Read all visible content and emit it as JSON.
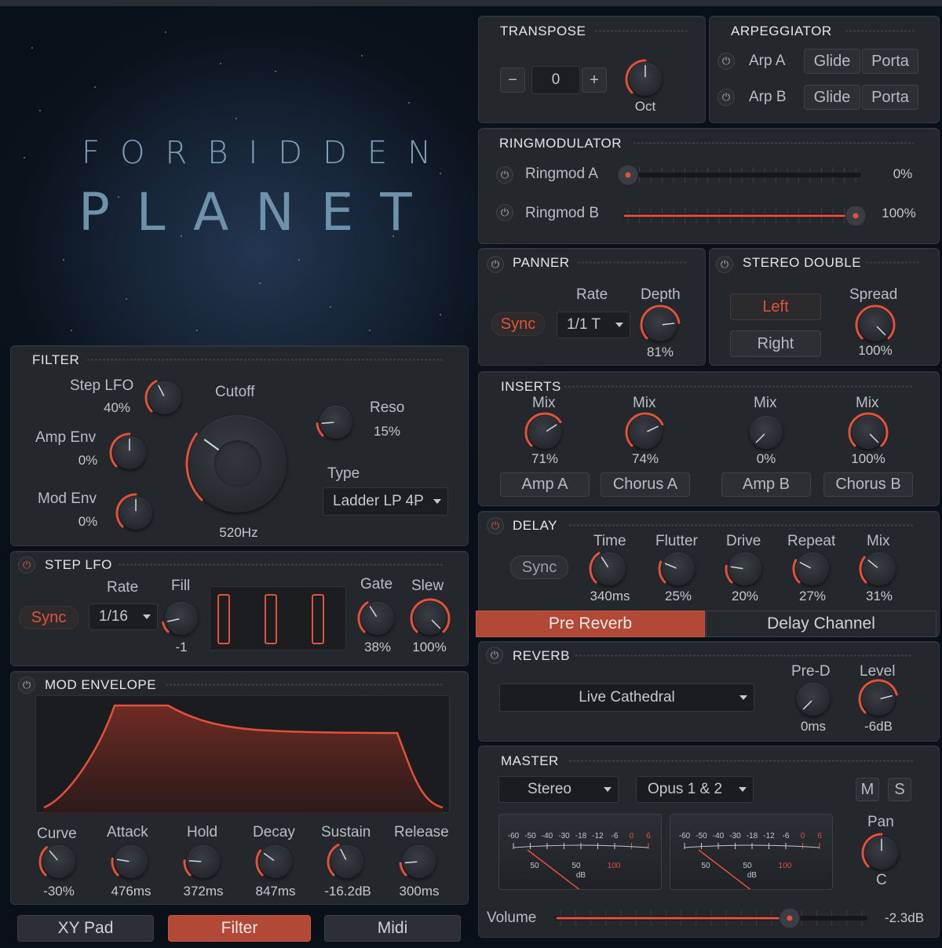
{
  "logo": {
    "line1": "FORBIDDEN",
    "line2": "PLANET"
  },
  "colors": {
    "accent": "#e2513a",
    "panel": "#24272c",
    "active_tab": "#b24936"
  },
  "transpose": {
    "title": "TRANSPOSE",
    "minus": "−",
    "plus": "+",
    "value": "0",
    "oct_label": "Oct"
  },
  "arpeggiator": {
    "title": "ARPEGGIATOR",
    "rows": [
      {
        "label": "Arp A",
        "glide": "Glide",
        "porta": "Porta"
      },
      {
        "label": "Arp B",
        "glide": "Glide",
        "porta": "Porta"
      }
    ]
  },
  "ringmod": {
    "title": "RINGMODULATOR",
    "a_label": "Ringmod A",
    "a_value": "0%",
    "a_level": 0.0,
    "b_label": "Ringmod B",
    "b_value": "100%",
    "b_level": 1.0
  },
  "panner": {
    "title": "PANNER",
    "sync": "Sync",
    "rate_label": "Rate",
    "rate_value": "1/1 T",
    "depth_label": "Depth",
    "depth_value": "81%",
    "depth_level": 0.81
  },
  "stereo_double": {
    "title": "STEREO DOUBLE",
    "left": "Left",
    "right": "Right",
    "spread_label": "Spread",
    "spread_value": "100%",
    "spread_level": 1.0
  },
  "inserts": {
    "title": "INSERTS",
    "items": [
      {
        "mix_label": "Mix",
        "value": "71%",
        "level": 0.71,
        "button": "Amp A"
      },
      {
        "mix_label": "Mix",
        "value": "74%",
        "level": 0.74,
        "button": "Chorus A"
      },
      {
        "mix_label": "Mix",
        "value": "0%",
        "level": 0.0,
        "button": "Amp B"
      },
      {
        "mix_label": "Mix",
        "value": "100%",
        "level": 1.0,
        "button": "Chorus B"
      }
    ]
  },
  "delay": {
    "title": "DELAY",
    "sync": "Sync",
    "knobs": [
      {
        "label": "Time",
        "value": "340ms",
        "level": 0.38
      },
      {
        "label": "Flutter",
        "value": "25%",
        "level": 0.25
      },
      {
        "label": "Drive",
        "value": "20%",
        "level": 0.2
      },
      {
        "label": "Repeat",
        "value": "27%",
        "level": 0.27
      },
      {
        "label": "Mix",
        "value": "31%",
        "level": 0.31
      }
    ],
    "tab_pre": "Pre Reverb",
    "tab_channel": "Delay Channel"
  },
  "reverb": {
    "title": "REVERB",
    "preset": "Live Cathedral",
    "pred_label": "Pre-D",
    "pred_value": "0ms",
    "pred_level": 0.0,
    "level_label": "Level",
    "level_value": "-6dB",
    "level_level": 0.78
  },
  "master": {
    "title": "MASTER",
    "output": "Stereo",
    "channel": "Opus 1 & 2",
    "m": "M",
    "s": "S",
    "pan_label": "Pan",
    "pan_value": "C",
    "meter_scale": [
      "-60",
      "-50",
      "-40",
      "-30",
      "-18",
      "-12",
      "-6",
      "0",
      "6"
    ],
    "meter_low": [
      "50",
      "50",
      "100"
    ],
    "meter_unit": "dB",
    "volume_label": "Volume",
    "volume_value": "-2.3dB",
    "volume_level": 0.76
  },
  "filter": {
    "title": "FILTER",
    "step_lfo_label": "Step LFO",
    "step_lfo_value": "40%",
    "step_lfo_level": 0.4,
    "amp_env_label": "Amp Env",
    "amp_env_value": "0%",
    "mod_env_label": "Mod Env",
    "mod_env_value": "0%",
    "cutoff_label": "Cutoff",
    "cutoff_value": "520Hz",
    "cutoff_level": 0.3,
    "reso_label": "Reso",
    "reso_value": "15%",
    "reso_level": 0.15,
    "type_label": "Type",
    "type_value": "Ladder LP 4P"
  },
  "step_lfo": {
    "title": "STEP LFO",
    "sync": "Sync",
    "rate_label": "Rate",
    "rate_value": "1/16",
    "fill_label": "Fill",
    "fill_value": "-1",
    "fill_level": 0.12,
    "gate_label": "Gate",
    "gate_value": "38%",
    "gate_level": 0.38,
    "slew_label": "Slew",
    "slew_value": "100%",
    "slew_level": 1.0
  },
  "mod_envelope": {
    "title": "MOD ENVELOPE",
    "knobs": [
      {
        "label": "Curve",
        "value": "-30%",
        "level": 0.35
      },
      {
        "label": "Attack",
        "value": "476ms",
        "level": 0.2
      },
      {
        "label": "Hold",
        "value": "372ms",
        "level": 0.18
      },
      {
        "label": "Decay",
        "value": "847ms",
        "level": 0.3
      },
      {
        "label": "Sustain",
        "value": "-16.2dB",
        "level": 0.4
      },
      {
        "label": "Release",
        "value": "300ms",
        "level": 0.15
      }
    ]
  },
  "bottom_tabs": [
    {
      "label": "XY Pad"
    },
    {
      "label": "Filter"
    },
    {
      "label": "Midi"
    }
  ]
}
